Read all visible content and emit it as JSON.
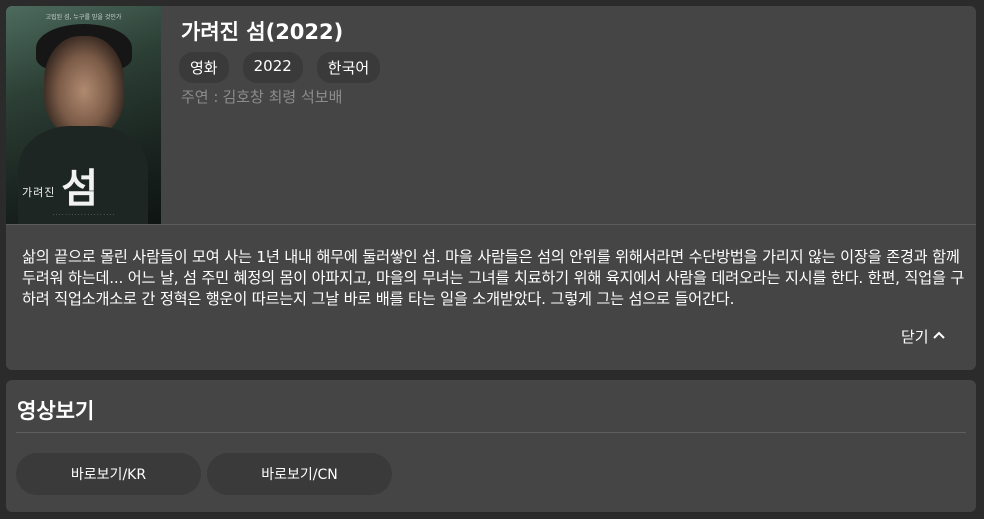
{
  "movie": {
    "title": "가려진 섬(2022)",
    "tags": [
      "영화",
      "2022",
      "한국어"
    ],
    "cast_label": "주연 :",
    "cast_names": "김호창 최령 석보배",
    "synopsis": "삶의 끝으로 몰린 사람들이 모여 사는 1년 내내 해무에 둘러쌓인 섬. 마을 사람들은 섬의 안위를 위해서라면 수단방법을 가리지 않는 이장을 존경과 함께 두려워 하는데... 어느 날, 섬 주민 혜정의 몸이 아파지고, 마을의 무녀는 그녀를 치료하기 위해 육지에서 사람을 데려오라는 지시를 한다. 한편, 직업을 구하려 직업소개소로 간 정혁은 행운이 따르는지 그날 바로 배를 타는 일을 소개받았다. 그렇게 그는 섬으로 들어간다.",
    "collapse_label": "닫기",
    "collapse_icon": "chevron-up-icon"
  },
  "poster": {
    "tagline": "고립된 섬, 누구를 믿을 것인가",
    "title_small": "가려진",
    "title_big": "섬"
  },
  "watch": {
    "section_title": "영상보기",
    "buttons": [
      {
        "label": "바로보기/KR"
      },
      {
        "label": "바로보기/CN"
      }
    ]
  }
}
